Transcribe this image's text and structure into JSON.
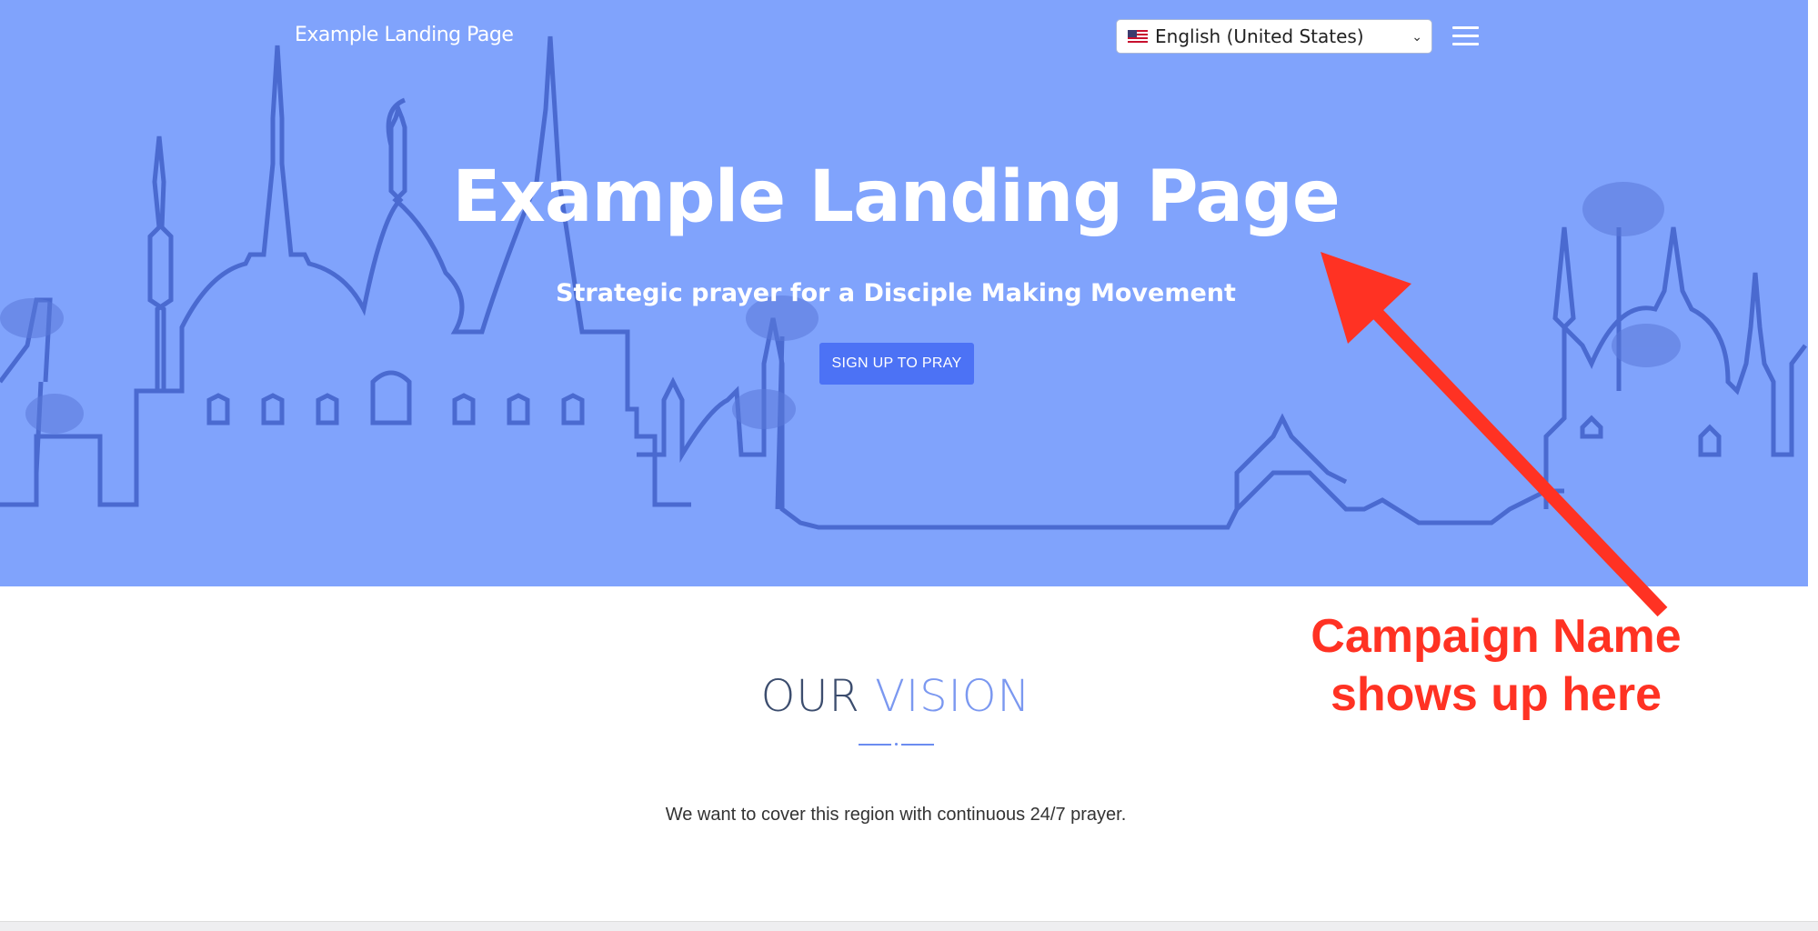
{
  "header": {
    "brand": "Example Landing Page",
    "language": "English (United States)",
    "flag_icon": "us-flag-icon",
    "menu_icon": "hamburger-menu-icon"
  },
  "hero": {
    "title": "Example Landing Page",
    "subtitle": "Strategic prayer for a Disciple Making Movement",
    "cta_label": "SIGN UP TO PRAY",
    "background_color": "#80a3fc",
    "cta_color": "#4c72f5"
  },
  "vision": {
    "title_word1": "OUR",
    "title_word2": "VISION",
    "text": "We want to cover this region with continuous 24/7 prayer."
  },
  "annotation": {
    "line1": "Campaign Name",
    "line2": "shows up here",
    "color": "#ff3223"
  }
}
